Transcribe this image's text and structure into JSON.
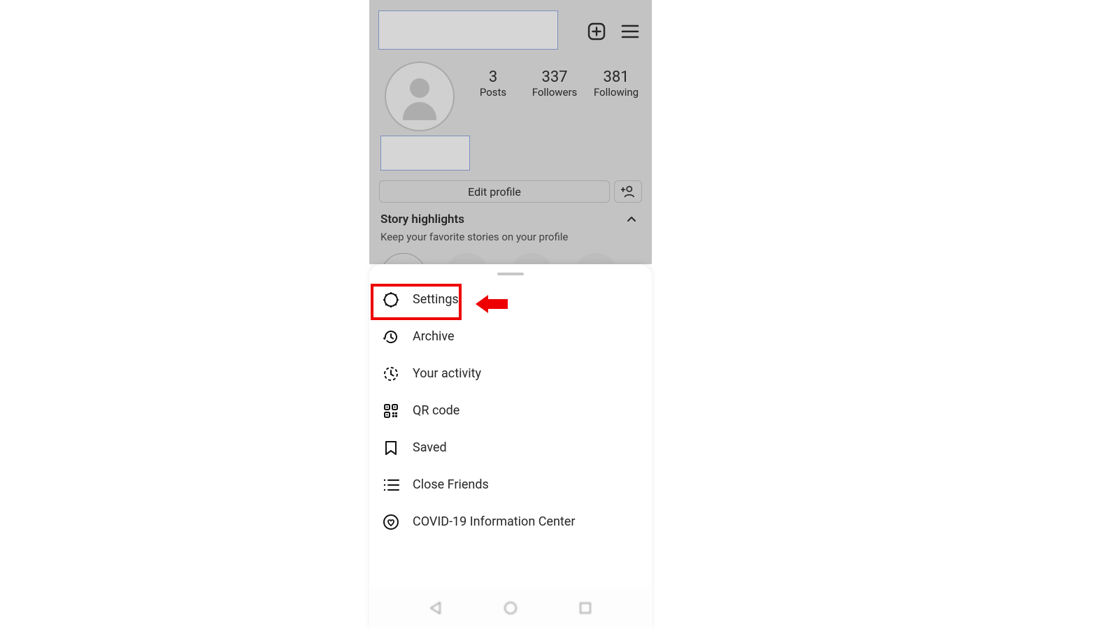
{
  "header": {
    "username": "",
    "bio": ""
  },
  "stats": {
    "posts_count": "3",
    "posts_label": "Posts",
    "followers_count": "337",
    "followers_label": "Followers",
    "following_count": "381",
    "following_label": "Following"
  },
  "actions": {
    "edit_profile": "Edit profile"
  },
  "highlights": {
    "title": "Story highlights",
    "subtitle": "Keep your favorite stories on your profile"
  },
  "menu": {
    "items": [
      {
        "label": "Settings"
      },
      {
        "label": "Archive"
      },
      {
        "label": "Your activity"
      },
      {
        "label": "QR code"
      },
      {
        "label": "Saved"
      },
      {
        "label": "Close Friends"
      },
      {
        "label": "COVID-19 Information Center"
      }
    ]
  },
  "annotation": {
    "highlighted_item_index": 0
  }
}
